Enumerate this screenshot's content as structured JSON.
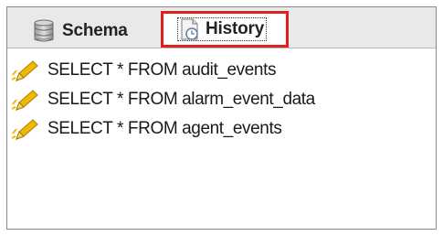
{
  "tabs": {
    "schema_label": "Schema",
    "history_label": "History"
  },
  "history": {
    "items": [
      {
        "label": "SELECT * FROM audit_events",
        "icon": "pencil-icon"
      },
      {
        "label": "SELECT * FROM alarm_event_data",
        "icon": "pencil-icon"
      },
      {
        "label": "SELECT * FROM agent_events",
        "icon": "pencil-icon"
      }
    ]
  },
  "colors": {
    "highlight_border": "#e02020",
    "tabbar_bg": "#e9e9e9",
    "pencil_yellow": "#f2b705"
  }
}
